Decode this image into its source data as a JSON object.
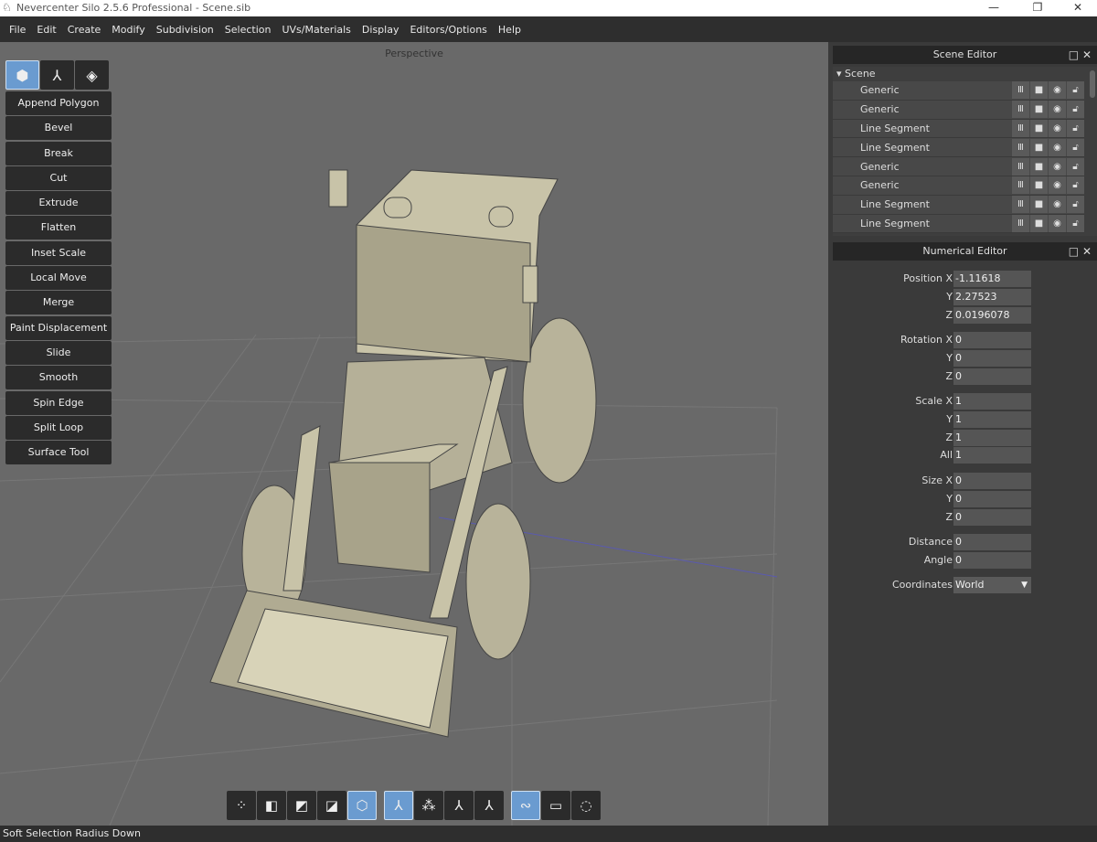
{
  "window": {
    "title": "Nevercenter Silo 2.5.6 Professional - Scene.sib",
    "controls": [
      "minimize",
      "restore",
      "close"
    ]
  },
  "menu": [
    "File",
    "Edit",
    "Create",
    "Modify",
    "Subdivision",
    "Selection",
    "UVs/Materials",
    "Display",
    "Editors/Options",
    "Help"
  ],
  "viewport": {
    "label": "Perspective"
  },
  "modes": [
    {
      "icon": "polygon-mode-icon",
      "active": true
    },
    {
      "icon": "manipulator-icon",
      "active": false
    },
    {
      "icon": "uv-icon",
      "active": false
    }
  ],
  "tools": [
    "Append Polygon",
    "Bevel",
    "Break",
    "Cut",
    "Extrude",
    "Flatten",
    "Inset Scale",
    "Local Move",
    "Merge",
    "Paint Displacement",
    "Slide",
    "Smooth",
    "Spin Edge",
    "Split Loop",
    "Surface Tool"
  ],
  "bottom_toolbar": [
    {
      "icon": "vertex-select-icon",
      "active": false
    },
    {
      "icon": "edge-select-icon",
      "active": false
    },
    {
      "icon": "face-select-icon",
      "active": false
    },
    {
      "icon": "object-vertex-icon",
      "active": false
    },
    {
      "icon": "object-select-icon",
      "active": true
    },
    {
      "icon": "move-manipulator-icon",
      "active": true
    },
    {
      "icon": "scale-manipulator-icon",
      "active": false
    },
    {
      "icon": "rotate-manipulator-icon",
      "active": false
    },
    {
      "icon": "universal-manipulator-icon",
      "active": false
    },
    {
      "icon": "paint-select-icon",
      "active": true
    },
    {
      "icon": "rectangle-select-icon",
      "active": false
    },
    {
      "icon": "lasso-select-icon",
      "active": false
    }
  ],
  "status": "Soft Selection Radius Down",
  "scene_editor": {
    "title": "Scene Editor",
    "root": "Scene",
    "items": [
      "Generic",
      "Generic",
      "Line Segment",
      "Line Segment",
      "Generic",
      "Generic",
      "Line Segment",
      "Line Segment"
    ]
  },
  "numerical_editor": {
    "title": "Numerical Editor",
    "fields": [
      {
        "label": "Position X",
        "value": "-1.11618"
      },
      {
        "label": "Y",
        "value": "2.27523"
      },
      {
        "label": "Z",
        "value": "0.0196078"
      },
      {
        "label": "Rotation X",
        "value": "0"
      },
      {
        "label": "Y",
        "value": "0"
      },
      {
        "label": "Z",
        "value": "0"
      },
      {
        "label": "Scale X",
        "value": "1"
      },
      {
        "label": "Y",
        "value": "1"
      },
      {
        "label": "Z",
        "value": "1"
      },
      {
        "label": "All",
        "value": "1"
      },
      {
        "label": "Size X",
        "value": "0"
      },
      {
        "label": "Y",
        "value": "0"
      },
      {
        "label": "Z",
        "value": "0"
      },
      {
        "label": "Distance",
        "value": "0"
      },
      {
        "label": "Angle",
        "value": "0"
      }
    ],
    "coordinates": {
      "label": "Coordinates",
      "value": "World"
    }
  },
  "colors": {
    "accent": "#6a9bd0",
    "viewport": "#696969",
    "model": "#c8c3a8"
  }
}
